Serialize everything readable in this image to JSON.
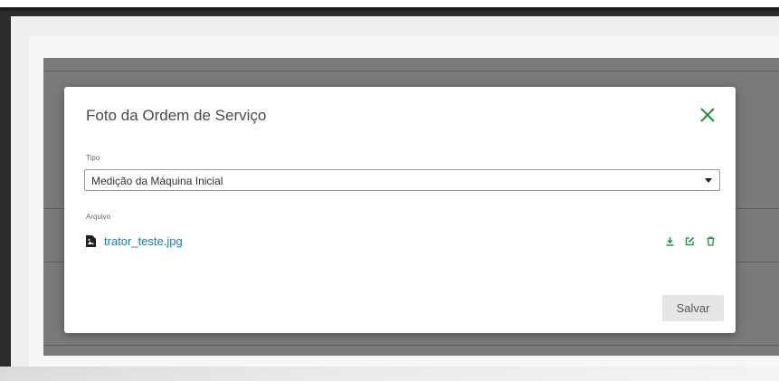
{
  "modal": {
    "title": "Foto da Ordem de Serviço",
    "close_icon": "close-icon",
    "tipo_label": "Tipo",
    "tipo_value": "Medição da Máquina Inicial",
    "arquivo_label": "Arquivo",
    "file_name": "trator_teste.jpg",
    "actions": [
      "download-icon",
      "edit-icon",
      "delete-icon"
    ],
    "save_label": "Salvar"
  },
  "colors": {
    "accent": "#1e8e3e",
    "link": "#1f7aa8",
    "overlay": "#7a7a7a"
  }
}
